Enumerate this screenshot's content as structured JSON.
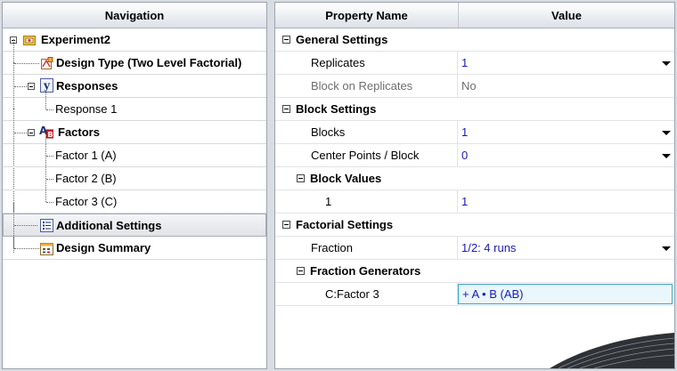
{
  "navigation": {
    "header": "Navigation",
    "items": [
      {
        "label": "Experiment2",
        "icon": "experiment-folder-icon"
      },
      {
        "label": "Design Type (Two Level Factorial)",
        "icon": "design-type-icon"
      },
      {
        "label": "Responses",
        "icon": "response-y-icon"
      },
      {
        "label": "Response 1"
      },
      {
        "label": "Factors",
        "icon": "factors-ab-icon"
      },
      {
        "label": "Factor 1 (A)"
      },
      {
        "label": "Factor 2 (B)"
      },
      {
        "label": "Factor 3 (C)"
      },
      {
        "label": "Additional Settings",
        "icon": "settings-list-icon"
      },
      {
        "label": "Design Summary",
        "icon": "summary-calendar-icon"
      }
    ]
  },
  "grid": {
    "col_name": "Property Name",
    "col_value": "Value",
    "general": {
      "title": "General Settings",
      "replicates": {
        "name": "Replicates",
        "value": "1"
      },
      "block_on_replicates": {
        "name": "Block on Replicates",
        "value": "No"
      }
    },
    "block": {
      "title": "Block Settings",
      "blocks": {
        "name": "Blocks",
        "value": "1"
      },
      "center_points": {
        "name": "Center Points / Block",
        "value": "0"
      },
      "block_values": {
        "title": "Block Values",
        "row_name": "1",
        "row_value": "1"
      }
    },
    "factorial": {
      "title": "Factorial Settings",
      "fraction": {
        "name": "Fraction",
        "value": "1/2: 4 runs"
      },
      "generators": {
        "title": "Fraction Generators",
        "row_name": "C:Factor 3",
        "row_value": "+ A • B (AB)"
      }
    }
  },
  "colors": {
    "value_text": "#1a1ab8",
    "disabled_text": "#6d6d6d",
    "active_border": "#3aa6c7"
  }
}
